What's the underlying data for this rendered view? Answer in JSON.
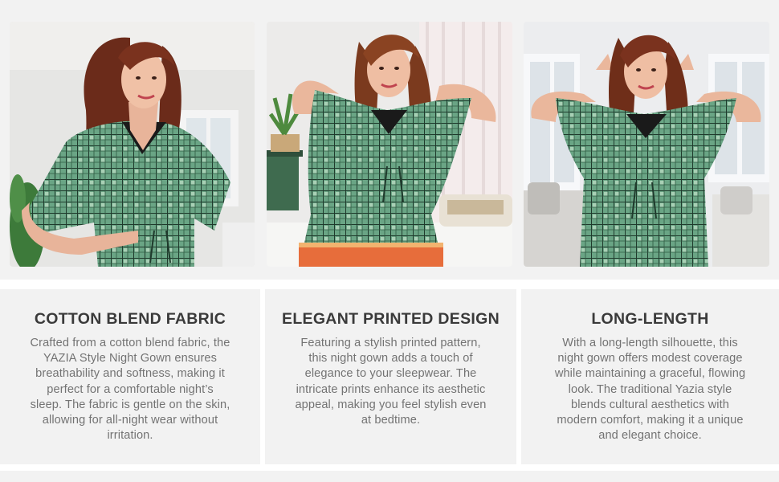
{
  "photos": [
    {
      "icon": "model-photo-front-pose"
    },
    {
      "icon": "model-photo-bedroom-pose"
    },
    {
      "icon": "model-photo-arms-raised-pose"
    }
  ],
  "features": [
    {
      "title": "COTTON BLEND FABRIC",
      "lines": [
        "Crafted from a cotton blend fabric, the",
        "YAZIA Style Night Gown ensures",
        "breathability and softness, making it",
        "perfect for a comfortable night’s",
        "sleep. The fabric is gentle on the skin,",
        "allowing for all-night wear without",
        "irritation."
      ]
    },
    {
      "title": "ELEGANT PRINTED DESIGN",
      "lines": [
        "Featuring a stylish printed pattern,",
        "this night gown adds a touch of",
        "elegance to your sleepwear. The",
        "intricate prints enhance its aesthetic",
        "appeal, making you feel stylish even",
        "at bedtime."
      ]
    },
    {
      "title": "LONG-LENGTH",
      "lines": [
        "With a long-length silhouette, this",
        "night gown offers modest coverage",
        "while maintaining a graceful, flowing",
        "look. The traditional Yazia style",
        "blends cultural aesthetics with",
        "modern comfort, making it a unique",
        "and elegant choice."
      ]
    }
  ],
  "colors": {
    "background": "#f2f2f2",
    "gown_green": "#5f9a7a",
    "check_lines": "#1f3a2c",
    "title_text": "#3a3a3a",
    "body_text": "#737373"
  }
}
